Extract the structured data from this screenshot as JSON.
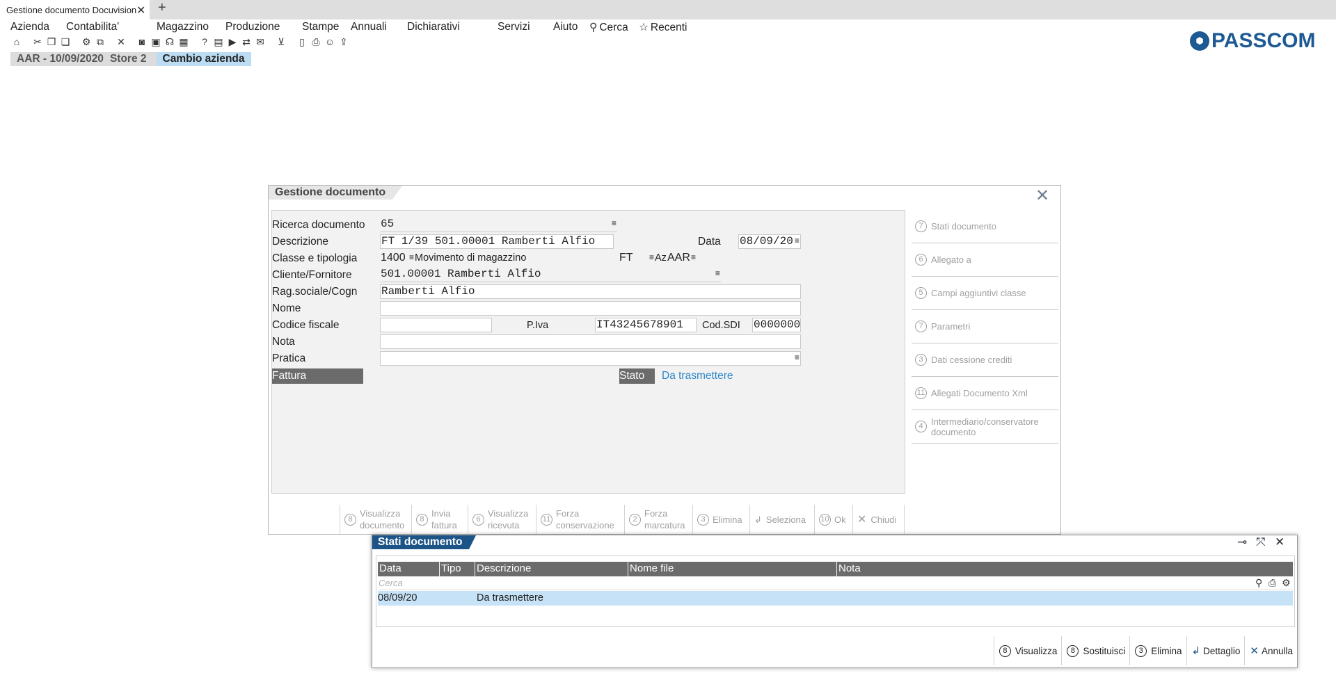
{
  "browser": {
    "tab_title": "Gestione documento Docuvision",
    "tab_close": "✕",
    "new_tab": "+"
  },
  "menu": {
    "items": [
      "Azienda",
      "Contabilita'",
      "Magazzino",
      "Produzione",
      "Stampe",
      "Annuali",
      "Dichiarativi",
      "Servizi",
      "Aiuto"
    ],
    "search_label": "Cerca",
    "recent_label": "Recenti"
  },
  "logo": {
    "text": "PASSCOM"
  },
  "company_bar": {
    "company": "AAR - 10/09/2020",
    "store": "Store 2",
    "change": "Cambio azienda"
  },
  "dialog": {
    "title": "Gestione documento",
    "labels": {
      "search_doc": "Ricerca documento",
      "description": "Descrizione",
      "date": "Data",
      "class_type": "Classe e tipologia",
      "warehouse_move": "Movimento di magazzino",
      "az": "Az",
      "customer": "Cliente/Fornitore",
      "company_name": "Rag.sociale/Cogn",
      "name": "Nome",
      "tax_code": "Codice fiscale",
      "vat": "P.Iva",
      "sdi": "Cod.SDI",
      "note": "Nota",
      "practice": "Pratica",
      "invoice": "Fattura",
      "state": "Stato"
    },
    "values": {
      "search_doc": "65",
      "description": "FT 1/39 501.00001 Ramberti Alfio",
      "date": "08/09/20",
      "class": "1400",
      "warehouse_move": "FT",
      "az_value": "AAR",
      "customer": "501.00001 Ramberti Alfio",
      "company_name": "Ramberti Alfio",
      "name": "",
      "tax_code": "",
      "vat": "IT43245678901",
      "sdi": "0000000",
      "note": "",
      "practice": "",
      "state": "Da trasmettere"
    },
    "side_actions": [
      {
        "key": "7",
        "label": "Stati documento"
      },
      {
        "key": "6",
        "label": "Allegato a"
      },
      {
        "key": "5",
        "label": "Campi aggiuntivi classe"
      },
      {
        "key": "7",
        "label": "Parametri"
      },
      {
        "key": "3",
        "label": "Dati cessione crediti"
      },
      {
        "key": "11",
        "label": "Allegati Documento Xml"
      },
      {
        "key": "4",
        "label": "Intermediario/conservatore documento"
      }
    ],
    "function_keys": [
      {
        "key": "8",
        "label": "Visualizza documento"
      },
      {
        "key": "8",
        "label": "Invia fattura"
      },
      {
        "key": "6",
        "label": "Visualizza ricevuta"
      },
      {
        "key": "11",
        "label": "Forza conservazione"
      },
      {
        "key": "2",
        "label": "Forza marcatura"
      },
      {
        "key": "3",
        "label": "Elimina"
      },
      {
        "key": "↲",
        "label": "Seleziona"
      },
      {
        "key": "10",
        "label": "Ok"
      },
      {
        "key": "✕",
        "label": "Chiudi"
      }
    ]
  },
  "stati": {
    "title": "Stati documento",
    "columns": [
      "Data",
      "Tipo",
      "Descrizione",
      "Nome file",
      "Nota"
    ],
    "search_placeholder": "Cerca",
    "rows": [
      {
        "data": "08/09/20",
        "tipo": "",
        "descrizione": "Da trasmettere",
        "nome_file": "",
        "nota": ""
      }
    ],
    "buttons": [
      {
        "key": "8",
        "label": "Visualizza"
      },
      {
        "key": "8",
        "label": "Sostituisci"
      },
      {
        "key": "3",
        "label": "Elimina"
      },
      {
        "key": "↲",
        "label": "Dettaglio"
      },
      {
        "key": "✕",
        "label": "Annulla"
      }
    ]
  }
}
